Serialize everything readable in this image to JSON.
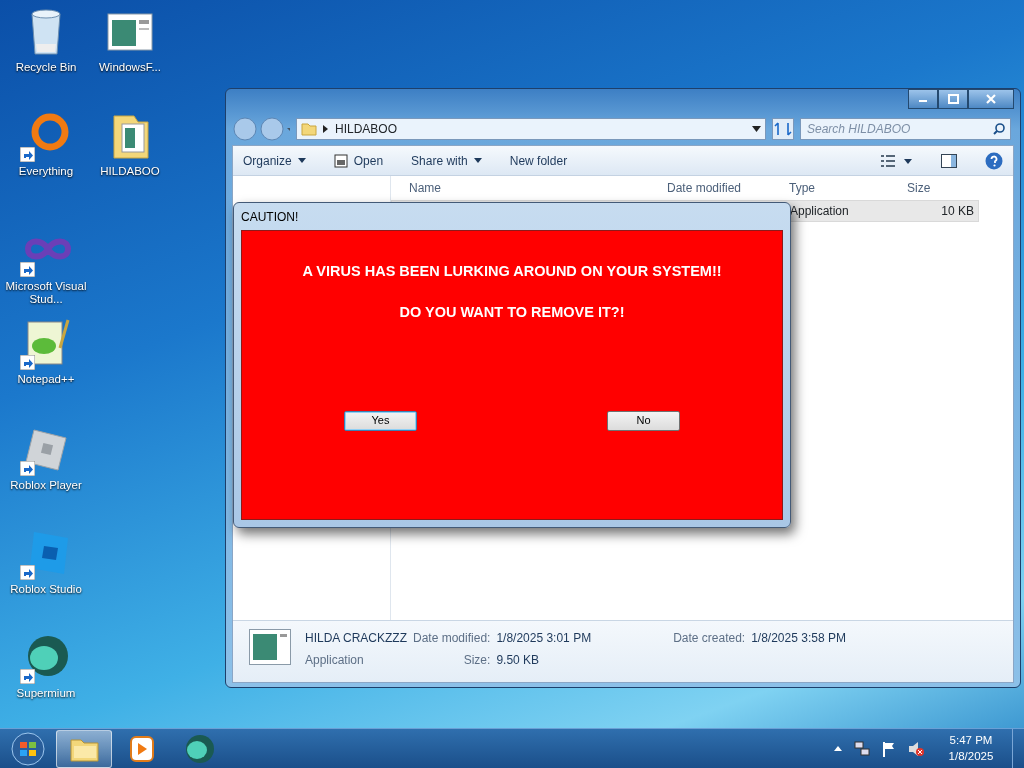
{
  "desktop_icons": [
    {
      "label": "Recycle Bin",
      "kind": "bin",
      "shortcut": false
    },
    {
      "label": "WindowsF...",
      "kind": "app",
      "shortcut": false
    },
    {
      "label": "Everything",
      "kind": "ring",
      "shortcut": true
    },
    {
      "label": "HILDABOO",
      "kind": "folder",
      "shortcut": false
    },
    {
      "label": "Microsoft Visual Stud...",
      "kind": "infinity",
      "shortcut": true
    },
    {
      "label": "Notepad++",
      "kind": "notepad",
      "shortcut": true
    },
    {
      "label": "Roblox Player",
      "kind": "roblox",
      "shortcut": true
    },
    {
      "label": "Roblox Studio",
      "kind": "studio",
      "shortcut": true
    },
    {
      "label": "Supermium",
      "kind": "sphere",
      "shortcut": true
    }
  ],
  "explorer": {
    "address": "HILDABOO",
    "search": {
      "placeholder": "Search HILDABOO"
    },
    "toolbar": [
      {
        "label": "Organize",
        "dropdown": true,
        "icon": false
      },
      {
        "label": "Open",
        "dropdown": false,
        "icon": true
      },
      {
        "label": "Share with",
        "dropdown": true,
        "icon": false
      },
      {
        "label": "New folder",
        "dropdown": false,
        "icon": false
      }
    ],
    "columns": [
      "Name",
      "Date modified",
      "Type",
      "Size"
    ],
    "rows": [
      {
        "type": "Application",
        "size": "10 KB",
        "selected": true
      }
    ],
    "details": {
      "name": "HILDA CRACKZZZ",
      "type": "Application",
      "modified_label": "Date modified:",
      "modified": "1/8/2025 3:01 PM",
      "created_label": "Date created:",
      "created": "1/8/2025 3:58 PM",
      "size_label": "Size:",
      "size": "9.50 KB"
    }
  },
  "dialog": {
    "title": "CAUTION!",
    "messages": [
      "A VIRUS HAS BEEN LURKING AROUND ON YOUR SYSTEM!!",
      "DO YOU WANT TO REMOVE IT?!"
    ],
    "buttons": [
      {
        "label": "Yes",
        "default": true
      },
      {
        "label": "No",
        "default": false
      }
    ]
  },
  "taskbar": {
    "pinned": [
      {
        "kind": "explorer",
        "selected": true
      },
      {
        "kind": "media",
        "selected": false
      },
      {
        "kind": "sphere",
        "selected": false
      }
    ],
    "time": "5:47 PM",
    "date": "1/8/2025"
  }
}
